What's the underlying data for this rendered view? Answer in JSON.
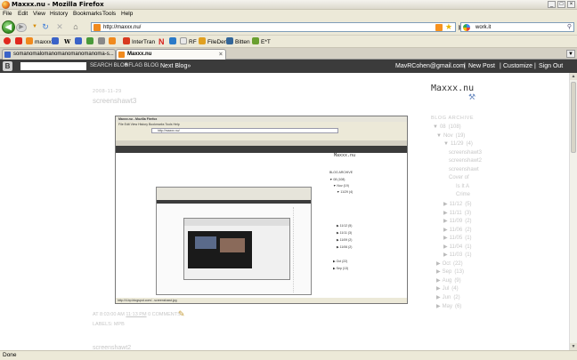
{
  "window": {
    "title": "Maxxx.nu - Mozilla Firefox",
    "buttons": [
      "_",
      "□",
      "×"
    ]
  },
  "menu": [
    "File",
    "Edit",
    "View",
    "History",
    "Bookmarks",
    "Tools",
    "Help"
  ],
  "toolbar": {
    "url": "http://maxxx.nu/",
    "search_value": "work.it",
    "icons": [
      "back-icon",
      "forward-icon",
      "reload-icon",
      "stop-icon",
      "home-icon"
    ]
  },
  "bookmarks": [
    {
      "label": "",
      "color": "#e0281e"
    },
    {
      "label": "maxxx",
      "color": "#f08a1e"
    },
    {
      "label": "",
      "color": "#3a63c8"
    },
    {
      "label": "W",
      "color": ""
    },
    {
      "label": "",
      "color": "#3a63c8"
    },
    {
      "label": "",
      "color": "#4a9a3a"
    },
    {
      "label": "",
      "color": "#888888"
    },
    {
      "label": "",
      "color": "#f08a1e"
    },
    {
      "label": "InterTran",
      "color": "#d83a20"
    },
    {
      "label": "N",
      "color": ""
    },
    {
      "label": "",
      "color": "#2a7ac8"
    },
    {
      "label": "RF",
      "color": "#e8e8e8"
    },
    {
      "label": "FileDen",
      "color": "#e0a020"
    },
    {
      "label": "Bitten",
      "color": "#336699"
    },
    {
      "label": "E*T",
      "color": "#6aa030"
    }
  ],
  "tabs": [
    {
      "label": "somanomalomanomanomanomanoma-s...",
      "active": false
    },
    {
      "label": "Maxxx.nu",
      "active": true
    }
  ],
  "blogger_nav": {
    "search_button": "SEARCH BLOG",
    "flag_button": "FLAG BLOG",
    "next_blog": "Next Blog»",
    "email": "MavRCohen@gmail.com",
    "new_post": "New Post",
    "customize": "Customize",
    "sign_out": "Sign Out"
  },
  "blog": {
    "title": "Maxxx.nu",
    "post": {
      "date": "2008-11-29",
      "title": "screenshawt3",
      "meta": "AT 8:03:00 AM",
      "time_link": "11:13 PM",
      "comments": "0 COMMENTS",
      "labels": "LABELS: MPB"
    },
    "post2_title": "screenshawt2"
  },
  "archive": {
    "title": "BLOG ARCHIVE",
    "items": [
      {
        "label": "08",
        "count": "(108)",
        "level": 0,
        "tri": "▼"
      },
      {
        "label": "Nov",
        "count": "(19)",
        "level": 1,
        "tri": "▼"
      },
      {
        "label": "11/29",
        "count": "(4)",
        "level": 2,
        "tri": "▼"
      },
      {
        "label": "screenshawt3",
        "count": "",
        "level": 3,
        "tri": ""
      },
      {
        "label": "screenshawt2",
        "count": "",
        "level": 3,
        "tri": ""
      },
      {
        "label": "screenshawt",
        "count": "",
        "level": 3,
        "tri": ""
      },
      {
        "label": "Cover of",
        "count": "",
        "level": 3,
        "tri": ""
      },
      {
        "label": "Is It A",
        "count": "",
        "level": 4,
        "tri": ""
      },
      {
        "label": "Crime",
        "count": "",
        "level": 4,
        "tri": ""
      },
      {
        "label": "11/12",
        "count": "(5)",
        "level": 2,
        "tri": "▶"
      },
      {
        "label": "11/11",
        "count": "(3)",
        "level": 2,
        "tri": "▶"
      },
      {
        "label": "11/09",
        "count": "(2)",
        "level": 2,
        "tri": "▶"
      },
      {
        "label": "11/06",
        "count": "(2)",
        "level": 2,
        "tri": "▶"
      },
      {
        "label": "11/05",
        "count": "(1)",
        "level": 2,
        "tri": "▶"
      },
      {
        "label": "11/04",
        "count": "(1)",
        "level": 2,
        "tri": "▶"
      },
      {
        "label": "11/03",
        "count": "(1)",
        "level": 2,
        "tri": "▶"
      },
      {
        "label": "Oct",
        "count": "(22)",
        "level": 1,
        "tri": "▶"
      },
      {
        "label": "Sep",
        "count": "(13)",
        "level": 1,
        "tri": "▶"
      },
      {
        "label": "Aug",
        "count": "(9)",
        "level": 1,
        "tri": "▶"
      },
      {
        "label": "Jul",
        "count": "(4)",
        "level": 1,
        "tri": "▶"
      },
      {
        "label": "Jun",
        "count": "(2)",
        "level": 1,
        "tri": "▶"
      },
      {
        "label": "May",
        "count": "(6)",
        "level": 1,
        "tri": "▶"
      }
    ]
  },
  "status": "Done",
  "colors": {
    "chrome": "#ece9d8",
    "blogger_bar": "#3b3b3b",
    "page_bg": "#ffffff",
    "pale_text": "#c7c7c7"
  }
}
